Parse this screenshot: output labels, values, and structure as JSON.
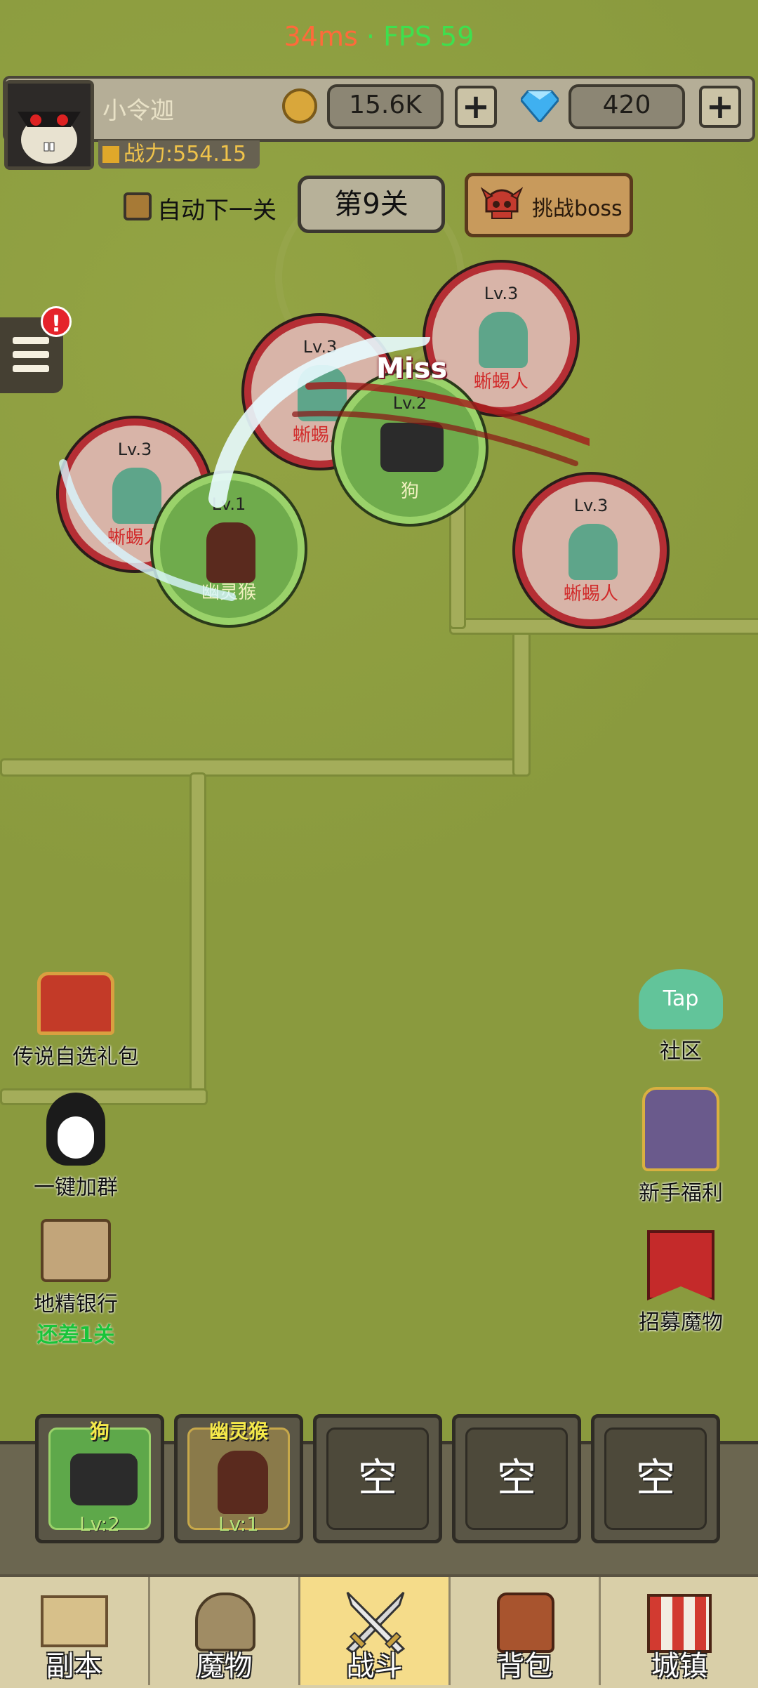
{
  "status": {
    "ping": "34ms",
    "sep": "·",
    "fps": "FPS 59"
  },
  "player": {
    "name": "小令迦",
    "power": "战力:554.15",
    "gold": "15.6K",
    "gems": "420"
  },
  "controls": {
    "auto_next": "自动下一关",
    "stage": "第9关",
    "boss_button": "挑战boss",
    "alert": "!"
  },
  "battle": {
    "miss": "Miss",
    "units": [
      {
        "lv": "Lv.3",
        "name": "蜥蜴人",
        "side": "enemy"
      },
      {
        "lv": "Lv.3",
        "name": "蜥蜴人",
        "side": "enemy"
      },
      {
        "lv": "Lv.3",
        "name": "蜥蜴人",
        "side": "enemy"
      },
      {
        "lv": "Lv.3",
        "name": "蜥蜴人",
        "side": "enemy"
      },
      {
        "lv": "Lv.2",
        "name": "狗",
        "side": "ally"
      },
      {
        "lv": "Lv.1",
        "name": "幽灵猴",
        "side": "ally"
      }
    ]
  },
  "side_left": [
    {
      "label": "传说自选礼包",
      "icon": "treasure-chest-icon"
    },
    {
      "label": "一键加群",
      "icon": "penguin-icon"
    },
    {
      "label": "地精银行",
      "sub": "还差1关",
      "icon": "bank-scroll-icon"
    }
  ],
  "side_right": [
    {
      "label": "社区",
      "badge": "Tap",
      "icon": "tap-cloud-icon"
    },
    {
      "label": "新手福利",
      "icon": "knight-icon"
    },
    {
      "label": "招募魔物",
      "icon": "banner-icon"
    }
  ],
  "slots": [
    {
      "name": "狗",
      "lv": "Lv:2"
    },
    {
      "name": "幽灵猴",
      "lv": "Lv:1"
    },
    {
      "empty": "空"
    },
    {
      "empty": "空"
    },
    {
      "empty": "空"
    }
  ],
  "nav": [
    "副本",
    "魔物",
    "战斗",
    "背包",
    "城镇"
  ],
  "colors": {
    "enemy_ring": "#b52e34",
    "ally_ring": "#9ad26a",
    "active_tab": "#f5dc8a",
    "boss_button": "#c89a5c"
  }
}
